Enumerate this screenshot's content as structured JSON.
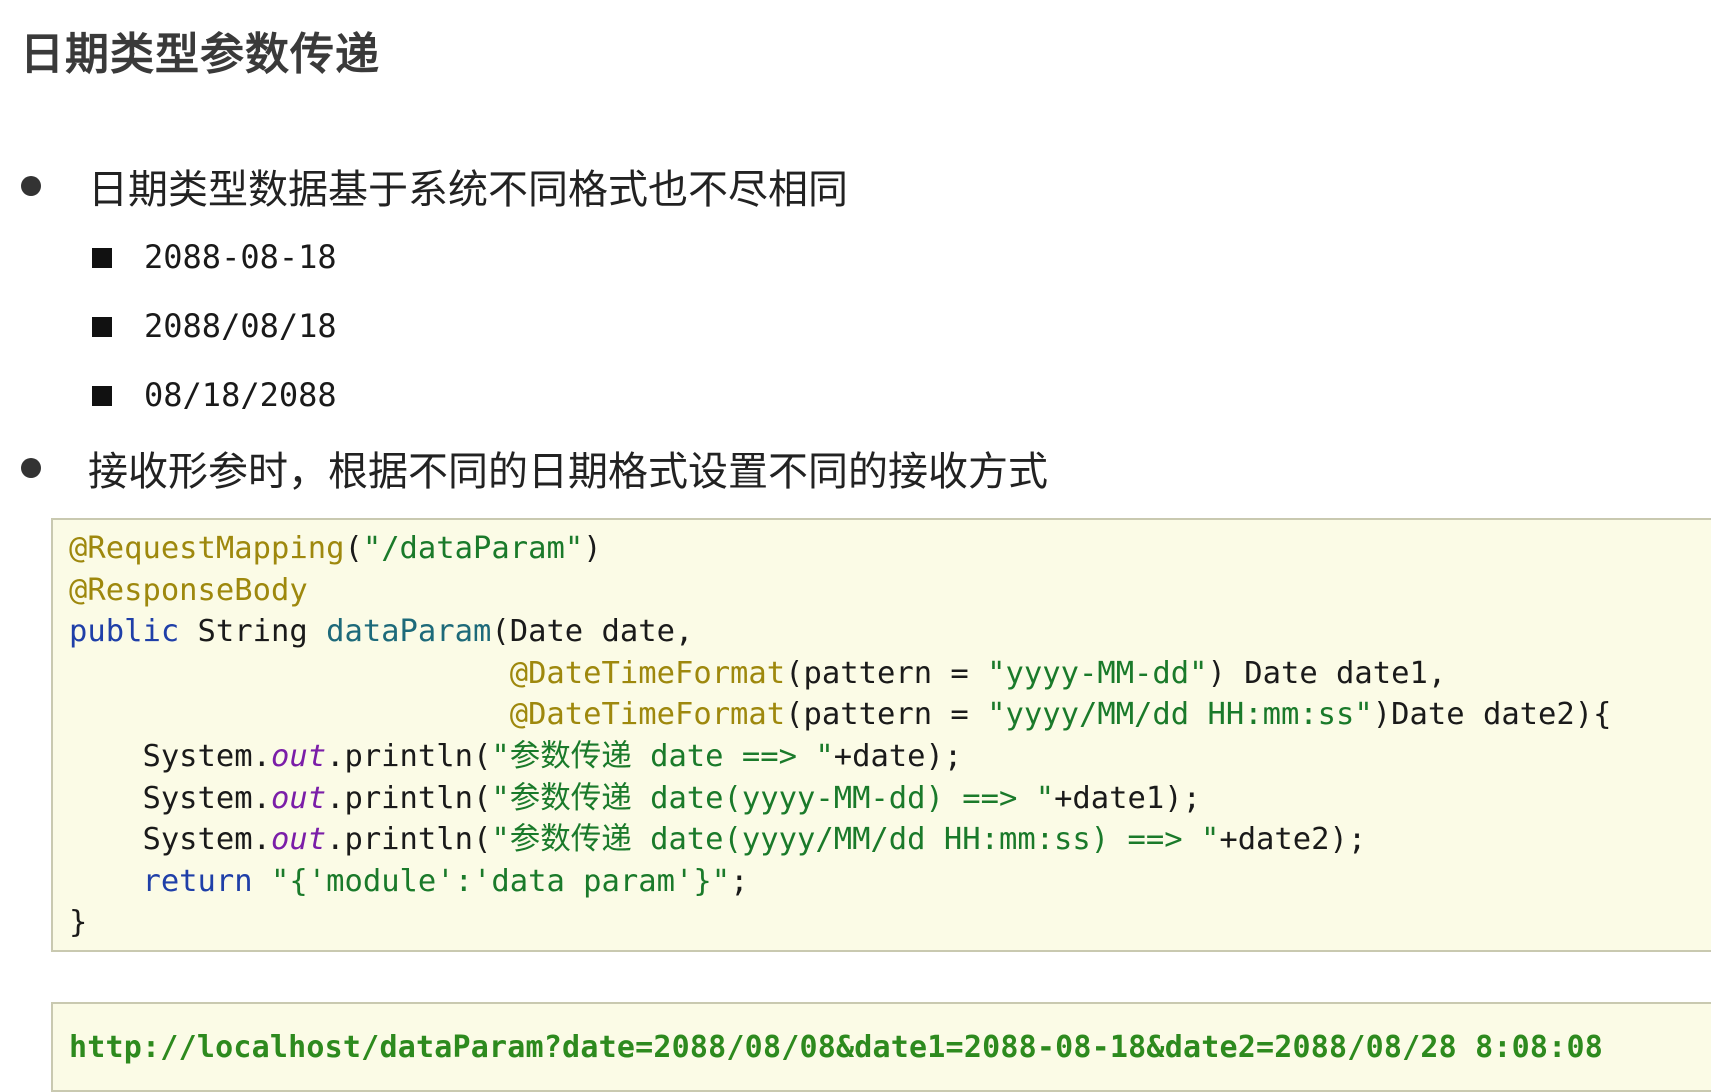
{
  "title": "日期类型参数传递",
  "bullets": [
    {
      "text": "日期类型数据基于系统不同格式也不尽相同",
      "sub_items": [
        "2088-08-18",
        "2088/08/18",
        "08/18/2088"
      ]
    },
    {
      "text": "接收形参时，根据不同的日期格式设置不同的接收方式"
    }
  ],
  "code": {
    "lines": [
      [
        {
          "t": "@RequestMapping",
          "k": "ann"
        },
        {
          "t": "(",
          "k": "plain"
        },
        {
          "t": "\"/dataParam\"",
          "k": "str"
        },
        {
          "t": ")",
          "k": "plain"
        }
      ],
      [
        {
          "t": "@ResponseBody",
          "k": "ann"
        }
      ],
      [
        {
          "t": "public",
          "k": "kw"
        },
        {
          "t": " String ",
          "k": "plain"
        },
        {
          "t": "dataParam",
          "k": "fn"
        },
        {
          "t": "(Date date,",
          "k": "plain"
        }
      ],
      [
        {
          "t": "                        ",
          "k": "plain"
        },
        {
          "t": "@DateTimeFormat",
          "k": "ann"
        },
        {
          "t": "(pattern = ",
          "k": "plain"
        },
        {
          "t": "\"yyyy-MM-dd\"",
          "k": "str"
        },
        {
          "t": ") Date date1,",
          "k": "plain"
        }
      ],
      [
        {
          "t": "                        ",
          "k": "plain"
        },
        {
          "t": "@DateTimeFormat",
          "k": "ann"
        },
        {
          "t": "(pattern = ",
          "k": "plain"
        },
        {
          "t": "\"yyyy/MM/dd HH:mm:ss\"",
          "k": "str"
        },
        {
          "t": ")Date date2){",
          "k": "plain"
        }
      ],
      [
        {
          "t": "    System.",
          "k": "plain"
        },
        {
          "t": "out",
          "k": "field"
        },
        {
          "t": ".println(",
          "k": "plain"
        },
        {
          "t": "\"参数传递 date ==> \"",
          "k": "str"
        },
        {
          "t": "+date);",
          "k": "plain"
        }
      ],
      [
        {
          "t": "    System.",
          "k": "plain"
        },
        {
          "t": "out",
          "k": "field"
        },
        {
          "t": ".println(",
          "k": "plain"
        },
        {
          "t": "\"参数传递 date(yyyy-MM-dd) ==> \"",
          "k": "str"
        },
        {
          "t": "+date1);",
          "k": "plain"
        }
      ],
      [
        {
          "t": "    System.",
          "k": "plain"
        },
        {
          "t": "out",
          "k": "field"
        },
        {
          "t": ".println(",
          "k": "plain"
        },
        {
          "t": "\"参数传递 date(yyyy/MM/dd HH:mm:ss) ==> \"",
          "k": "str"
        },
        {
          "t": "+date2);",
          "k": "plain"
        }
      ],
      [
        {
          "t": "    ",
          "k": "plain"
        },
        {
          "t": "return",
          "k": "kw"
        },
        {
          "t": " ",
          "k": "plain"
        },
        {
          "t": "\"{'module':'data param'}\"",
          "k": "str"
        },
        {
          "t": ";",
          "k": "plain"
        }
      ],
      [
        {
          "t": "}",
          "k": "plain"
        }
      ]
    ]
  },
  "url": "http://localhost/dataParam?date=2088/08/08&date1=2088-08-18&date2=2088/08/28 8:08:08",
  "colors": {
    "code_background": "#fbfbe6",
    "annotation": "#9e880d",
    "keyword": "#1f3fa8",
    "string": "#1a7a2a",
    "method": "#1d6a7a",
    "field": "#7b1ea8",
    "url": "#2d8a1e"
  }
}
